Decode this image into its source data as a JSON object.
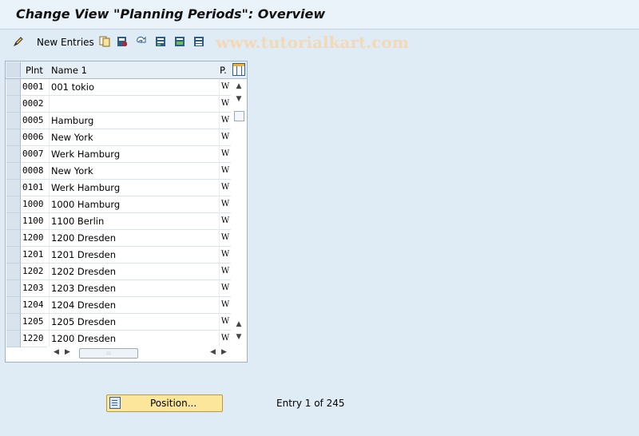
{
  "window": {
    "title": "Change View \"Planning Periods\": Overview"
  },
  "toolbar": {
    "new_entries_label": "New Entries",
    "watermark": "www.tutorialkart.com",
    "icons": [
      "edit-pencil-icon",
      "copy-icon",
      "delete-icon",
      "undo-icon",
      "select-all-icon",
      "select-block-icon",
      "deselect-all-icon"
    ]
  },
  "table": {
    "columns": {
      "plnt": "Plnt",
      "name": "Name 1",
      "period": "P."
    },
    "rows": [
      {
        "plnt": "0001",
        "name": "001 tokio",
        "period": "W"
      },
      {
        "plnt": "0002",
        "name": "",
        "period": "W"
      },
      {
        "plnt": "0005",
        "name": "Hamburg",
        "period": "W"
      },
      {
        "plnt": "0006",
        "name": "New York",
        "period": "W"
      },
      {
        "plnt": "0007",
        "name": "Werk Hamburg",
        "period": "W"
      },
      {
        "plnt": "0008",
        "name": "New York",
        "period": "W"
      },
      {
        "plnt": "0101",
        "name": "Werk Hamburg",
        "period": "W"
      },
      {
        "plnt": "1000",
        "name": "1000 Hamburg",
        "period": "W"
      },
      {
        "plnt": "1100",
        "name": "1100 Berlin",
        "period": "W"
      },
      {
        "plnt": "1200",
        "name": "1200 Dresden",
        "period": "W"
      },
      {
        "plnt": "1201",
        "name": "1201 Dresden",
        "period": "W"
      },
      {
        "plnt": "1202",
        "name": "1202 Dresden",
        "period": "W"
      },
      {
        "plnt": "1203",
        "name": "1203 Dresden",
        "period": "W"
      },
      {
        "plnt": "1204",
        "name": "1204 Dresden",
        "period": "W"
      },
      {
        "plnt": "1205",
        "name": "1205 Dresden",
        "period": "W"
      },
      {
        "plnt": "1220",
        "name": "1200 Dresden",
        "period": "W"
      }
    ]
  },
  "footer": {
    "position_label": "Position...",
    "entry_text": "Entry 1 of 245"
  }
}
